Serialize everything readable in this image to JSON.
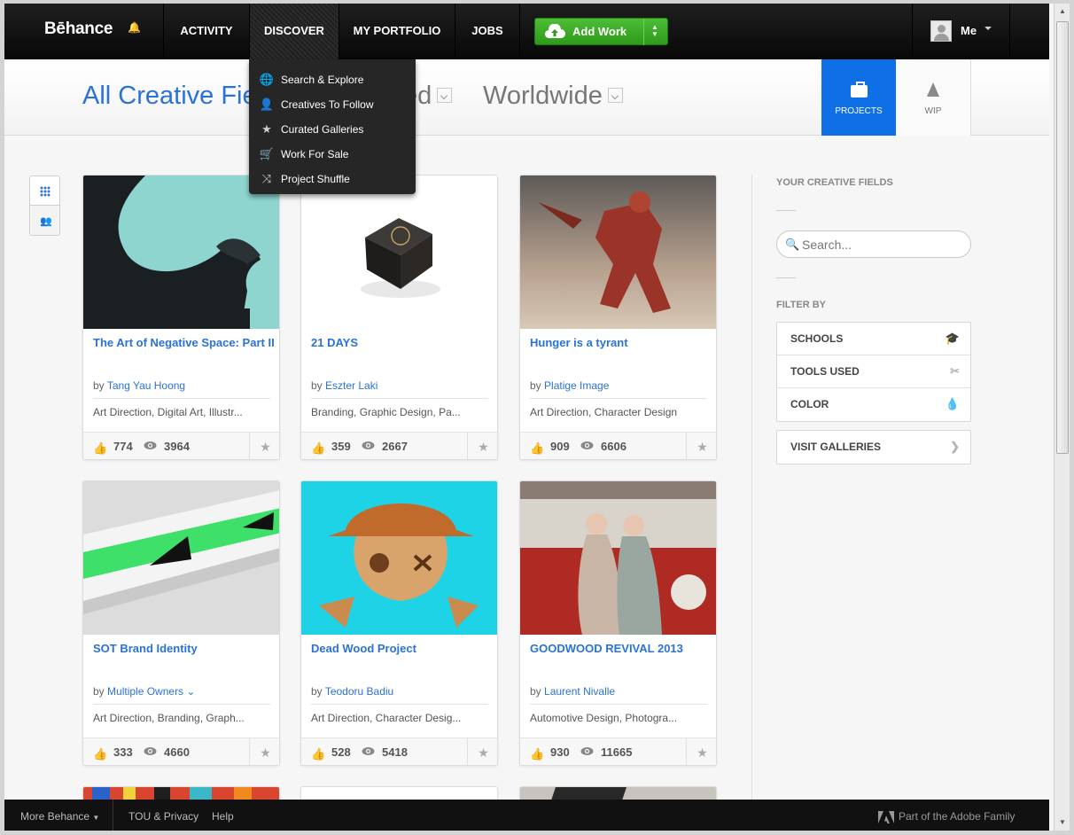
{
  "nav": {
    "logo": "Bēhance",
    "activity": "ACTIVITY",
    "discover": "DISCOVER",
    "portfolio": "MY PORTFOLIO",
    "jobs": "JOBS",
    "add_work": "Add Work",
    "me": "Me"
  },
  "discover_menu": [
    {
      "label": "Search & Explore",
      "icon": "globe-icon"
    },
    {
      "label": "Creatives To Follow",
      "icon": "person-icon"
    },
    {
      "label": "Curated Galleries",
      "icon": "ribbon-icon"
    },
    {
      "label": "Work For Sale",
      "icon": "cart-icon"
    },
    {
      "label": "Project Shuffle",
      "icon": "shuffle-icon"
    }
  ],
  "filters": {
    "field": "All Creative Fie",
    "sort": "ed",
    "region": "Worldwide"
  },
  "tabs": {
    "projects": "PROJECTS",
    "wip": "WIP"
  },
  "projects": [
    {
      "title": "The Art of Negative Space: Part II",
      "by": "by",
      "owner": "Tang Yau Hoong",
      "fields": "Art Direction, Digital Art, Illustr...",
      "appreciations": "774",
      "views": "3964"
    },
    {
      "title": "21 DAYS",
      "by": "by",
      "owner": "Eszter Laki",
      "fields": "Branding, Graphic Design, Pa...",
      "appreciations": "359",
      "views": "2667"
    },
    {
      "title": "Hunger is a tyrant",
      "by": "by",
      "owner": "Platige Image",
      "fields": "Art Direction, Character Design",
      "appreciations": "909",
      "views": "6606"
    },
    {
      "title": "SOT Brand Identity",
      "by": "by",
      "owner": "Multiple Owners",
      "fields": "Art Direction, Branding, Graph...",
      "appreciations": "333",
      "views": "4660"
    },
    {
      "title": "Dead Wood Project",
      "by": "by",
      "owner": "Teodoru Badiu",
      "fields": "Art Direction, Character Desig...",
      "appreciations": "528",
      "views": "5418"
    },
    {
      "title": "GOODWOOD REVIVAL 2013",
      "by": "by",
      "owner": "Laurent Nivalle",
      "fields": "Automotive Design, Photogra...",
      "appreciations": "930",
      "views": "11665"
    }
  ],
  "sidebar": {
    "creative_fields_heading": "YOUR CREATIVE FIELDS",
    "search_placeholder": "Search...",
    "filter_heading": "FILTER BY",
    "filters": [
      "SCHOOLS",
      "TOOLS USED",
      "COLOR"
    ],
    "visit_galleries": "VISIT GALLERIES"
  },
  "footer": {
    "more": "More Behance",
    "tou": "TOU & Privacy",
    "help": "Help",
    "adobe": "Part of the Adobe Family"
  },
  "colors": {
    "accent_blue": "#2a72d8",
    "projects_tab": "#0e6fe6",
    "add_work_green": "#3cab27",
    "topnav": "#111111"
  }
}
